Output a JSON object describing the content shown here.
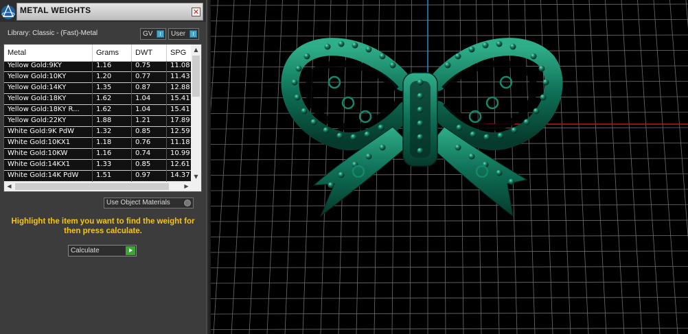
{
  "panel": {
    "title": "METAL WEIGHTS",
    "close_glyph": "✕",
    "library_label": "Library: Classic - (Fast)-Metal",
    "toggles": [
      {
        "label": "GV"
      },
      {
        "label": "User"
      }
    ],
    "table": {
      "headers": [
        "Metal",
        "Grams",
        "DWT",
        "SPG"
      ],
      "rows": [
        [
          "Yellow Gold:9KY",
          "1.16",
          "0.75",
          "11.08"
        ],
        [
          "Yellow Gold:10KY",
          "1.20",
          "0.77",
          "11.43"
        ],
        [
          "Yellow Gold:14KY",
          "1.35",
          "0.87",
          "12.88"
        ],
        [
          "Yellow Gold:18KY",
          "1.62",
          "1.04",
          "15.41"
        ],
        [
          "Yellow Gold:18KY R...",
          "1.62",
          "1.04",
          "15.41"
        ],
        [
          "Yellow Gold:22KY",
          "1.88",
          "1.21",
          "17.89"
        ],
        [
          "White Gold:9K PdW",
          "1.32",
          "0.85",
          "12.59"
        ],
        [
          "White Gold:10KX1",
          "1.18",
          "0.76",
          "11.18"
        ],
        [
          "White Gold:10KW",
          "1.16",
          "0.74",
          "10.99"
        ],
        [
          "White Gold:14KX1",
          "1.33",
          "0.85",
          "12.61"
        ],
        [
          "White Gold:14K PdW",
          "1.51",
          "0.97",
          "14.37"
        ]
      ]
    },
    "use_object_materials": "Use Object Materials",
    "instruction": "Highlight the item you want to find the weight for then press calculate.",
    "calculate_label": "Calculate"
  },
  "viewport": {
    "model": "bow-pendant",
    "colors": {
      "background": "#000000",
      "grid": "#6e6e6e",
      "axis_x": "#c01818",
      "axis_z": "#2f8fc6",
      "metal": "#0e6e55",
      "metal_highlight": "#2fae8a",
      "metal_shadow": "#063a2c"
    }
  },
  "icons": {
    "logo": "cad-logo-icon",
    "close": "close-icon",
    "toggle": "info-toggle-icon",
    "scroll_up": "chevron-up-icon",
    "scroll_down": "chevron-down-icon",
    "scroll_left": "chevron-left-icon",
    "scroll_right": "chevron-right-icon",
    "calculate": "play-icon"
  }
}
